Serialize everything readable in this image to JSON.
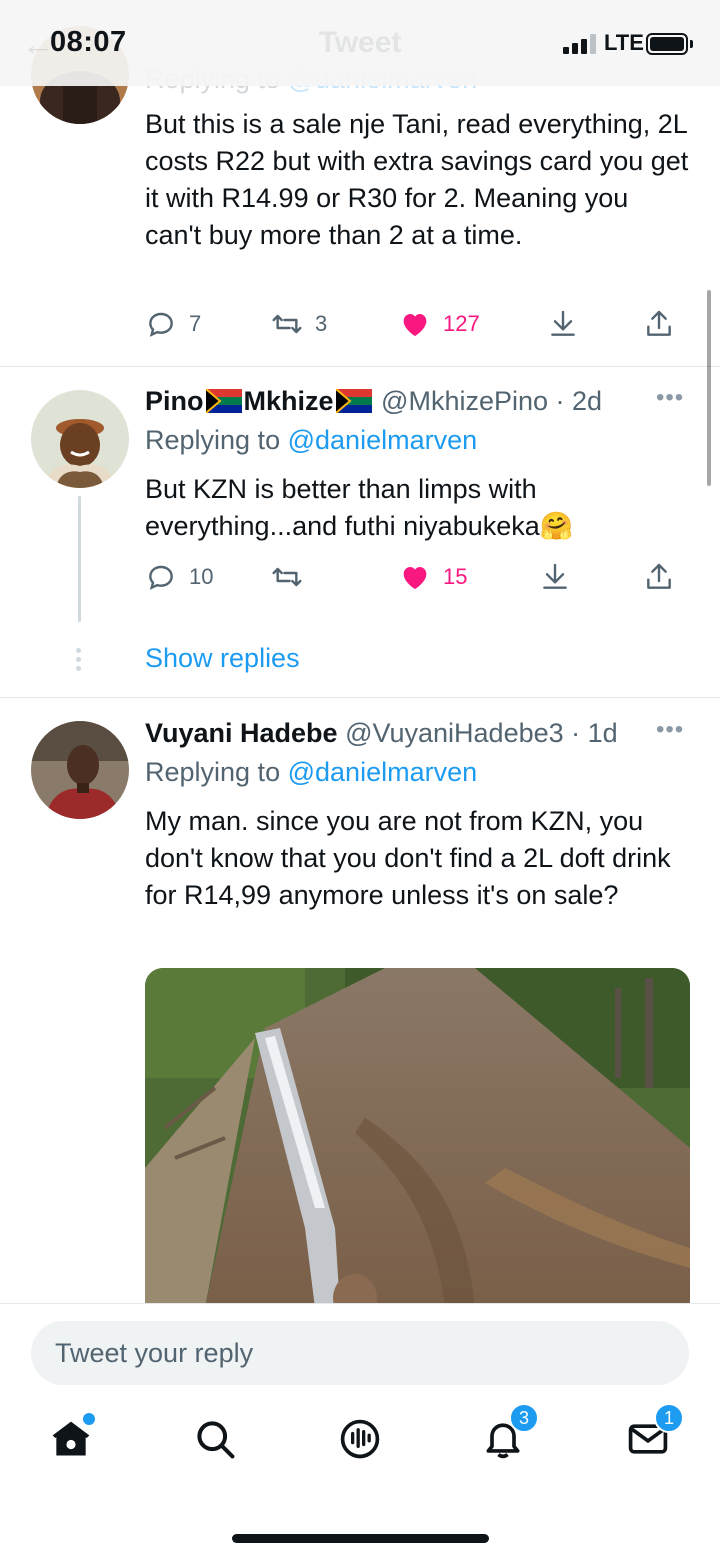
{
  "status_bar": {
    "time": "08:07",
    "network": "LTE"
  },
  "nav": {
    "title": "Tweet"
  },
  "tweets": [
    {
      "replying_label": "Replying to",
      "replying_handle": "@danielmarven",
      "text": "But this is a sale nje Tani, read everything, 2L costs R22 but with extra savings card you get it with R14.99 or R30 for 2. Meaning you can't buy more than 2 at a time.",
      "replies": "7",
      "retweets": "3",
      "likes": "127"
    },
    {
      "name_part1": "Pino",
      "name_part2": "Mkhize",
      "handle": "@MkhizePino",
      "time": "· 2d",
      "replying_label": "Replying to",
      "replying_handle": "@danielmarven",
      "text": "But KZN is better than limps with everything...and futhi niyabukeka",
      "emoji": "🤗",
      "replies": "10",
      "retweets": "",
      "likes": "15",
      "show_replies": "Show replies"
    },
    {
      "name": "Vuyani Hadebe",
      "handle": "@VuyaniHadebe3",
      "time": "· 1d",
      "replying_label": "Replying to",
      "replying_handle": "@danielmarven",
      "text": "My man. since you are not from KZN, you don't know that you don't find a 2L doft drink for R14,99 anymore unless it's on sale?"
    }
  ],
  "reply_box": {
    "placeholder": "Tweet your reply"
  },
  "tabbar": {
    "icons": [
      "home-icon",
      "search-icon",
      "spaces-icon",
      "notifications-icon",
      "messages-icon"
    ],
    "notifications_badge": "3",
    "messages_badge": "1"
  },
  "colors": {
    "accent": "#1d9bf0",
    "like": "#f91880",
    "muted": "#536471"
  }
}
